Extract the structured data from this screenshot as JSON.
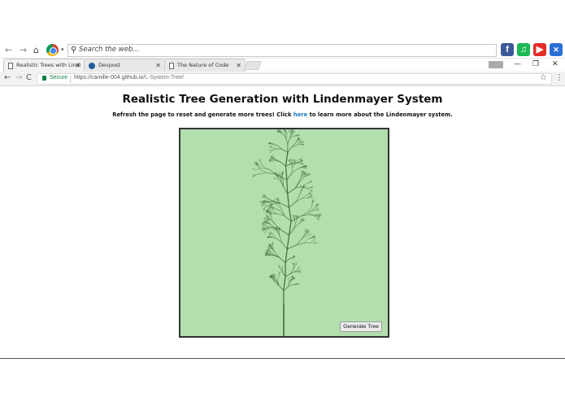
{
  "toolbar": {
    "search_placeholder": "Search the web..."
  },
  "tabs": [
    {
      "label": "Realistic Trees with Lindi",
      "active": true
    },
    {
      "label": "Devpost",
      "active": false
    },
    {
      "label": "The Nature of Code",
      "active": false
    }
  ],
  "address_bar": {
    "secure_label": "Secure",
    "url_host": "https://camille-004.github.io",
    "url_path": "/L-System-Tree/"
  },
  "page": {
    "title": "Realistic Tree Generation with Lindenmayer System",
    "subtitle_before": "Refresh the page to reset and generate more trees! Click ",
    "subtitle_link": "here",
    "subtitle_after": " to learn more about the Lindenmayer system.",
    "button_label": "Generate Tree"
  },
  "colors": {
    "canvas_bg": "#b2dfad",
    "tree_stroke": "#3d6b3a",
    "link": "#1a7bbf"
  },
  "icons": [
    "back-arrow-icon",
    "forward-arrow-icon",
    "home-icon",
    "chrome-icon",
    "search-icon",
    "facebook-icon",
    "music-icon",
    "youtube-icon",
    "gamepad-icon",
    "page-icon",
    "devpost-icon",
    "reload-icon",
    "lock-icon",
    "star-icon",
    "menu-icon",
    "close-icon",
    "minimize-icon",
    "restore-icon"
  ]
}
